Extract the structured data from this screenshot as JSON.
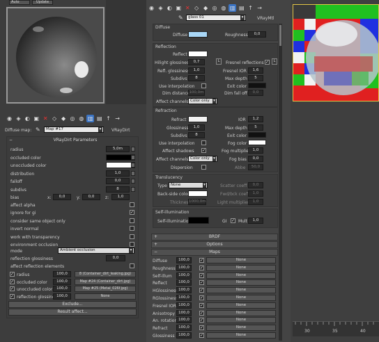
{
  "top_tabs": {
    "auto": "Auto",
    "update": "Update"
  },
  "left": {
    "map_label": "Diffuse map:",
    "map_name": "Map #17",
    "map_type": "VRayDirt",
    "params_title": "VRayDirt Parameters",
    "rows": [
      {
        "label": "radius",
        "value": "5,0m"
      },
      {
        "label": "occluded color",
        "swatch": "#000000"
      },
      {
        "label": "unoccluded color",
        "swatch": "#ffffff"
      },
      {
        "label": "distribution",
        "value": "1,0"
      },
      {
        "label": "falloff",
        "value": "0,0"
      },
      {
        "label": "subdivs",
        "value": "8"
      }
    ],
    "bias_label": "bias",
    "bias": {
      "x": "0,0",
      "y": "0,0",
      "z": "1,0"
    },
    "checks": [
      {
        "label": "affect alpha",
        "checked": false
      },
      {
        "label": "ignore for gi",
        "checked": true
      },
      {
        "label": "consider same object only",
        "checked": false
      },
      {
        "label": "invert normal",
        "checked": false
      },
      {
        "label": "work with transparency",
        "checked": false
      },
      {
        "label": "environment occlusion",
        "checked": false
      }
    ],
    "mode_label": "mode",
    "mode_value": "Ambient occlusion",
    "reflection_glossiness_label": "reflection glossiness",
    "reflection_glossiness_value": "0,0",
    "affect_reflection_label": "affect reflection elements",
    "maps": [
      {
        "label": "radius",
        "value": "100,0",
        "name": "8 (Container_dirt_leaking.jpg)"
      },
      {
        "label": "occluded color",
        "value": "100,0",
        "name": "Map #24 (Container_dirt.jpg)"
      },
      {
        "label": "unoccluded color",
        "value": "100,0",
        "name": "Map #25 (Metal_026f.jpg)"
      },
      {
        "label": "reflection glossiness",
        "value": "100,0",
        "name": "None"
      }
    ],
    "exclude": "Exclude...",
    "result_affect": "Result affect..."
  },
  "mid": {
    "material_name": "glass 01",
    "material_type": "VRayMtl",
    "diffuse_title": "Diffuse",
    "diffuse_label": "Diffuse",
    "roughness_label": "Roughness",
    "roughness_value": "0,0",
    "reflection_title": "Reflection",
    "reflect_label": "Reflect",
    "hilight_label": "Hilight glossiness",
    "hilight_value": "0,7",
    "fresnel_label": "Fresnel reflections",
    "refl_gloss_label": "Refl. glossiness",
    "refl_gloss_value": "1,0",
    "fresnel_ior_label": "Fresnel IOR",
    "fresnel_ior_value": "1,6",
    "subdivs_label": "Subdivs",
    "subdivs_value": "8",
    "max_depth_label": "Max depth",
    "max_depth_value": "5",
    "use_interp_label": "Use interpolation",
    "exit_color_label": "Exit color",
    "dim_dist_label": "Dim distance",
    "dim_dist_value": "100,0m",
    "dim_falloff_label": "Dim fall off",
    "dim_falloff_value": "0,0",
    "affect_channels_label": "Affect channels",
    "affect_channels_value": "Color only",
    "refraction_title": "Refraction",
    "refract_label": "Refract",
    "ior_label": "IOR",
    "ior_value": "1,2",
    "glossiness_label": "Glossiness",
    "glossiness_value": "1,0",
    "r_max_depth_value": "5",
    "r_subdivs_value": "8",
    "affect_shadows_label": "Affect shadows",
    "fog_color_label": "Fog color",
    "fog_mult_label": "Fog multiplier",
    "fog_mult_value": "1,0",
    "fog_bias_label": "Fog bias",
    "fog_bias_value": "0,0",
    "dispersion_label": "Dispersion",
    "abbe_label": "Abbe",
    "abbe_value": "50,0",
    "translucency_title": "Translucency",
    "type_label": "Type",
    "type_value": "None",
    "scatter_label": "Scatter coeff",
    "scatter_value": "0,0",
    "backside_label": "Back-side color",
    "fwdbck_label": "Fwd/bck coeff",
    "fwdbck_value": "1,0",
    "thickness_label": "Thickness",
    "thickness_value": "1000,0m",
    "light_mult_label": "Light multiplier",
    "light_mult_value": "1,0",
    "selfillum_title": "Self-illumination",
    "selfillum_label": "Self-illumination",
    "gi_label": "GI",
    "mult_label": "Mult",
    "mult_value": "1,0",
    "brdf": "BRDF",
    "options": "Options",
    "maps_title": "Maps",
    "map_rows": [
      {
        "label": "Diffuse",
        "value": "100,0",
        "name": "None"
      },
      {
        "label": "Roughness",
        "value": "100,0",
        "name": "None"
      },
      {
        "label": "Self-illum",
        "value": "100,0",
        "name": "None"
      },
      {
        "label": "Reflect",
        "value": "100,0",
        "name": "None"
      },
      {
        "label": "HGlossiness",
        "value": "100,0",
        "name": "None"
      },
      {
        "label": "RGlossiness",
        "value": "100,0",
        "name": "None"
      },
      {
        "label": "Fresnel IOR",
        "value": "100,0",
        "name": "None"
      },
      {
        "label": "Anisotropy",
        "value": "100,0",
        "name": "None"
      },
      {
        "label": "An. rotation",
        "value": "100,0",
        "name": "None"
      },
      {
        "label": "Refract",
        "value": "100,0",
        "name": "None"
      },
      {
        "label": "Glossiness",
        "value": "100,0",
        "name": "None"
      }
    ]
  },
  "timeline": {
    "ticks": [
      "30",
      "35",
      "40"
    ]
  }
}
